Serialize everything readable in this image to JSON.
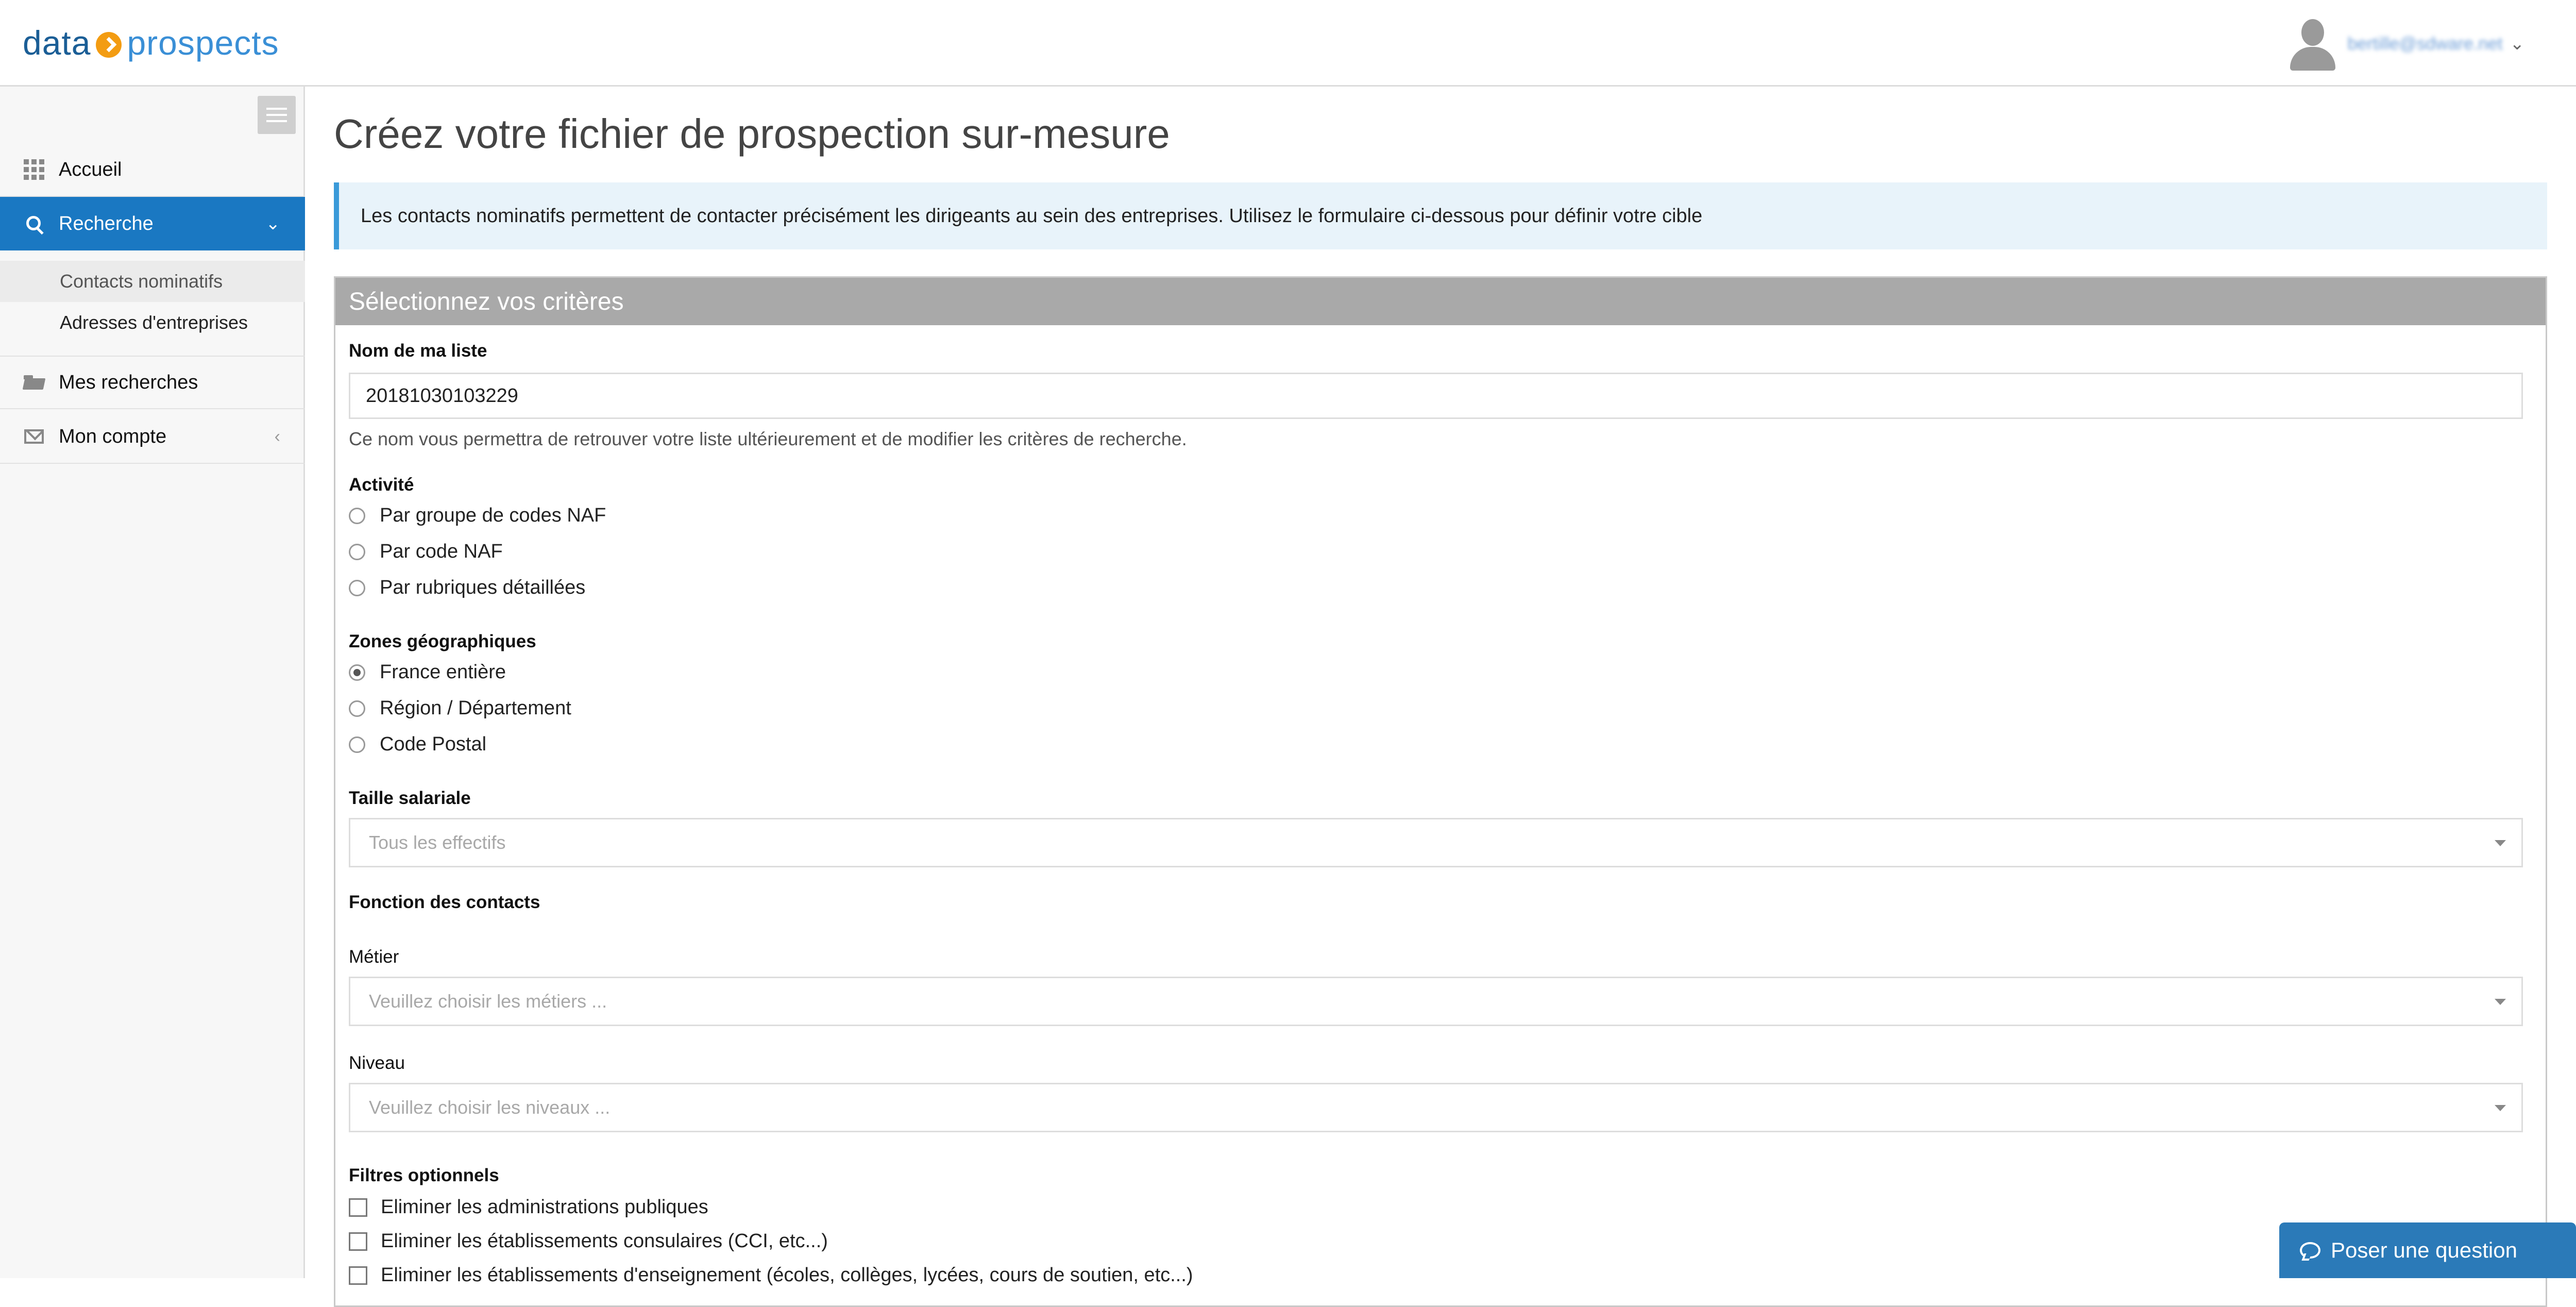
{
  "header": {
    "logo_word1": "data",
    "logo_word2": "prospects",
    "user_email": "bertille@sdware.net",
    "user_menu_icon": "chevron-down-icon"
  },
  "sidebar": {
    "items": [
      {
        "label": "Accueil",
        "icon": "grid-icon"
      },
      {
        "label": "Recherche",
        "icon": "search-icon",
        "active": true
      },
      {
        "label": "Mes recherches",
        "icon": "folder-icon"
      },
      {
        "label": "Mon compte",
        "icon": "envelope-icon"
      }
    ],
    "subitems": [
      {
        "label": "Contacts nominatifs",
        "current": true
      },
      {
        "label": "Adresses d'entreprises"
      }
    ],
    "chevron_down": "⌄",
    "chevron_left": "‹"
  },
  "main": {
    "title": "Créez votre fichier de prospection sur-mesure",
    "info": "Les contacts nominatifs permettent de contacter précisément les dirigeants au sein des entreprises. Utilisez le formulaire ci-dessous pour définir votre cible",
    "panel_title": "Sélectionnez vos critères",
    "list_name": {
      "label": "Nom de ma liste",
      "value": "20181030103229",
      "help": "Ce nom vous permettra de retrouver votre liste ultérieurement et de modifier les critères de recherche."
    },
    "activite": {
      "label": "Activité",
      "options": [
        "Par groupe de codes NAF",
        "Par code NAF",
        "Par rubriques détaillées"
      ]
    },
    "zones": {
      "label": "Zones géographiques",
      "options": [
        "France entière",
        "Région / Département",
        "Code Postal"
      ],
      "selected": "France entière"
    },
    "taille": {
      "label": "Taille salariale",
      "placeholder": "Tous les effectifs"
    },
    "fonction": {
      "label": "Fonction des contacts",
      "metier_label": "Métier",
      "metier_placeholder": "Veuillez choisir les métiers ...",
      "niveau_label": "Niveau",
      "niveau_placeholder": "Veuillez choisir les niveaux ..."
    },
    "filtres": {
      "label": "Filtres optionnels",
      "options": [
        "Eliminer les administrations publiques",
        "Eliminer les établissements consulaires (CCI, etc...)",
        "Eliminer les établissements d'enseignement (écoles, collèges, lycées, cours de soutien, etc...)"
      ]
    }
  },
  "chat": {
    "label": "Poser une question"
  },
  "colors": {
    "accent": "#1a78c2",
    "panel_header": "#a9a9a9",
    "info_bg": "#e8f3fa",
    "logo_orange": "#f39c12"
  }
}
